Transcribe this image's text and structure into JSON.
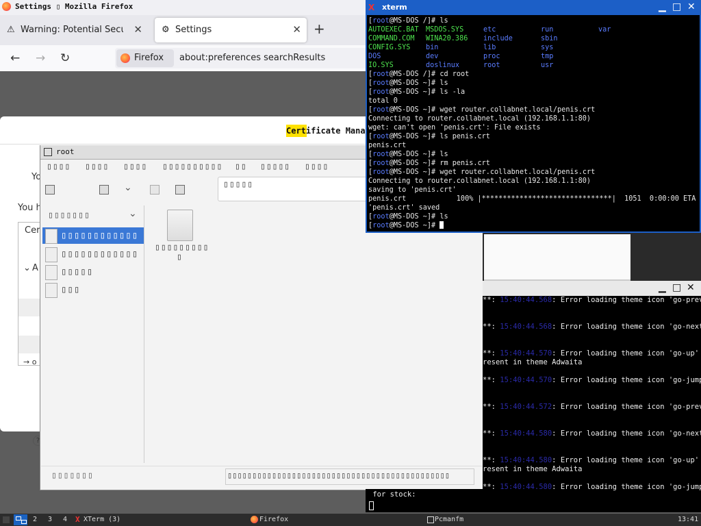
{
  "firefox": {
    "title": "Settings ▯ Mozilla Firefox",
    "tabs": [
      {
        "label": "Warning: Potential Security Risk",
        "close": "✕"
      },
      {
        "label": "Settings",
        "close": "✕"
      }
    ],
    "new_tab": "+",
    "url_badge": "Firefox",
    "url": "about:preferences  searchResults",
    "dialog_title": "Certificate Manager",
    "dialog_texts": [
      "Yo",
      "You h",
      "Cer",
      "A",
      "→ o"
    ],
    "help": "?"
  },
  "pcmanfm": {
    "title": "root",
    "menu": [
      "▯▯▯▯",
      "▯▯▯▯",
      "▯▯▯▯",
      "▯▯▯▯▯▯▯▯▯▯",
      "▯▯",
      "▯▯▯▯▯",
      "▯▯▯▯"
    ],
    "path": "▯▯▯▯▯",
    "side_header": "▯▯▯▯▯▯▯",
    "side_items": [
      "▯▯▯▯▯▯▯▯▯▯▯▯",
      "▯▯▯▯▯▯▯▯▯▯▯▯",
      "▯▯▯▯▯",
      "▯▯▯"
    ],
    "file_label_1": "▯▯▯▯▯▯▯▯▯",
    "file_label_2": "▯",
    "status_left": "▯▯▯▯▯▯▯",
    "status_right": "▯▯▯▯▯▯▯▯▯▯▯▯▯▯▯▯▯▯▯▯▯▯▯▯▯▯▯▯▯▯▯▯▯▯▯▯▯▯▯▯▯▯▯▯▯"
  },
  "xterm1": {
    "title": "xterm",
    "prompt": "root",
    "host": "@MS-DOS",
    "ls_grid": [
      [
        [
          "AUTOEXEC.BAT",
          "g"
        ],
        [
          "MSDOS.SYS",
          "g"
        ],
        [
          "etc",
          "b"
        ],
        [
          "run",
          "b"
        ],
        [
          "var",
          "b"
        ]
      ],
      [
        [
          "COMMAND.COM",
          "g"
        ],
        [
          "WINA20.386",
          "g"
        ],
        [
          "include",
          "b"
        ],
        [
          "sbin",
          "b"
        ],
        [
          "",
          ""
        ]
      ],
      [
        [
          "CONFIG.SYS",
          "g"
        ],
        [
          "bin",
          "b"
        ],
        [
          "lib",
          "b"
        ],
        [
          "sys",
          "b"
        ],
        [
          "",
          ""
        ]
      ],
      [
        [
          "DOS",
          "b"
        ],
        [
          "dev",
          "b"
        ],
        [
          "proc",
          "b"
        ],
        [
          "tmp",
          "b"
        ],
        [
          "",
          ""
        ]
      ],
      [
        [
          "IO.SYS",
          "g"
        ],
        [
          "doslinux",
          "b"
        ],
        [
          "root",
          "b"
        ],
        [
          "usr",
          "b"
        ],
        [
          "",
          ""
        ]
      ]
    ],
    "lines": [
      {
        "p": "/",
        "cmd": "ls"
      },
      {
        "grid": true
      },
      {
        "p": "/",
        "cmd": "cd root"
      },
      {
        "p": "~",
        "cmd": "ls"
      },
      {
        "p": "~",
        "cmd": "ls -la"
      },
      {
        "out": "total 0"
      },
      {
        "p": "~",
        "cmd": "wget router.collabnet.local/penis.crt"
      },
      {
        "out": "Connecting to router.collabnet.local (192.168.1.1:80)"
      },
      {
        "out": "wget: can't open 'penis.crt': File exists"
      },
      {
        "p": "~",
        "cmd": "ls penis.crt"
      },
      {
        "out": "penis.crt"
      },
      {
        "p": "~",
        "cmd": "ls"
      },
      {
        "p": "~",
        "cmd": "rm penis.crt"
      },
      {
        "p": "~",
        "cmd": "wget router.collabnet.local/penis.crt"
      },
      {
        "out": "Connecting to router.collabnet.local (192.168.1.1:80)"
      },
      {
        "out": "saving to 'penis.crt'"
      },
      {
        "out": "penis.crt            100% |*******************************|  1051  0:00:00 ETA"
      },
      {
        "out": "'penis.crt' saved"
      },
      {
        "p": "~",
        "cmd": "ls"
      },
      {
        "p": "~",
        "cmd": "",
        "cursor": true
      }
    ]
  },
  "xterm2": {
    "lines": [
      {
        "ts": "15:40:44.568",
        "msg": "Error loading theme icon 'go-previ"
      },
      {
        "blank": true
      },
      {
        "blank": true
      },
      {
        "ts": "15:40:44.568",
        "msg": "Error loading theme icon 'go-next'"
      },
      {
        "blank": true
      },
      {
        "blank": true
      },
      {
        "ts": "15:40:44.570",
        "msg": "Error loading theme icon 'go-up' f"
      },
      {
        "plain": "resent in theme Adwaita"
      },
      {
        "blank": true
      },
      {
        "ts": "15:40:44.570",
        "msg": "Error loading theme icon 'go-jump'"
      },
      {
        "blank": true
      },
      {
        "blank": true
      },
      {
        "ts": "15:40:44.572",
        "msg": "Error loading theme icon 'go-previ"
      },
      {
        "blank": true
      },
      {
        "blank": true
      },
      {
        "ts": "15:40:44.580",
        "msg": "Error loading theme icon 'go-next'"
      },
      {
        "blank": true
      },
      {
        "blank": true
      },
      {
        "ts": "15:40:44.580",
        "msg": "Error loading theme icon 'go-up' f"
      },
      {
        "plain": "resent in theme Adwaita"
      },
      {
        "blank": true
      },
      {
        "ts": "15:40:44.580",
        "msg": "Error loading theme icon 'go-jump'"
      }
    ],
    "prefix": "**: "
  },
  "xterm3": {
    "line1": " for stock:"
  },
  "taskbar": {
    "workspaces": [
      "2",
      "3",
      "4"
    ],
    "tasks": [
      {
        "label": "XTerm (3)"
      },
      {
        "label": "Firefox"
      },
      {
        "label": "Pcmanfm"
      }
    ],
    "clock": "13:41"
  }
}
